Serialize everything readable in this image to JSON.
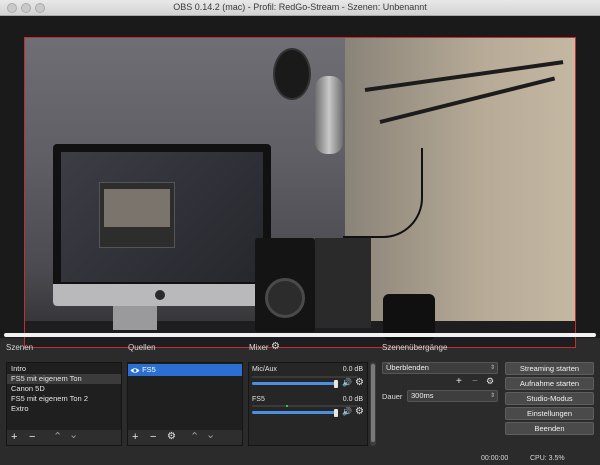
{
  "window": {
    "title": "OBS 0.14.2 (mac) - Profil: RedGo-Stream - Szenen: Unbenannt"
  },
  "docks": {
    "scenes_label": "Szenen",
    "sources_label": "Quellen",
    "mixer_label": "Mixer",
    "transitions_label": "Szenenübergänge"
  },
  "scenes": {
    "items": [
      "Intro",
      "FS5 mit eigenem Ton",
      "Canon 5D",
      "FS5 mit eigenem Ton 2",
      "Extro"
    ],
    "selected_index": 1
  },
  "sources": {
    "items": [
      {
        "name": "FS5",
        "visible": true
      }
    ]
  },
  "mixer": {
    "channels": [
      {
        "name": "Mic/Aux",
        "db": "0.0 dB",
        "volume": 1.0
      },
      {
        "name": "FS5",
        "db": "0.0 dB",
        "volume": 1.0
      }
    ]
  },
  "transitions": {
    "selected": "Überblenden",
    "duration_label": "Dauer",
    "duration_value": "300ms"
  },
  "controls": {
    "streaming": "Streaming starten",
    "recording": "Aufnahme starten",
    "studio": "Studio-Modus",
    "settings": "Einstellungen",
    "exit": "Beenden"
  },
  "status": {
    "time": "00:00:00",
    "cpu": "CPU: 3.5%"
  },
  "icons": {
    "add": "+",
    "remove": "−",
    "up": "⌃",
    "down": "⌄",
    "gear": "⚙",
    "eye": "eye-icon",
    "speaker": "🔊"
  },
  "colors": {
    "accent": "#2a6fd1",
    "preview_border": "#c03030",
    "slider": "#4a8fe0"
  }
}
